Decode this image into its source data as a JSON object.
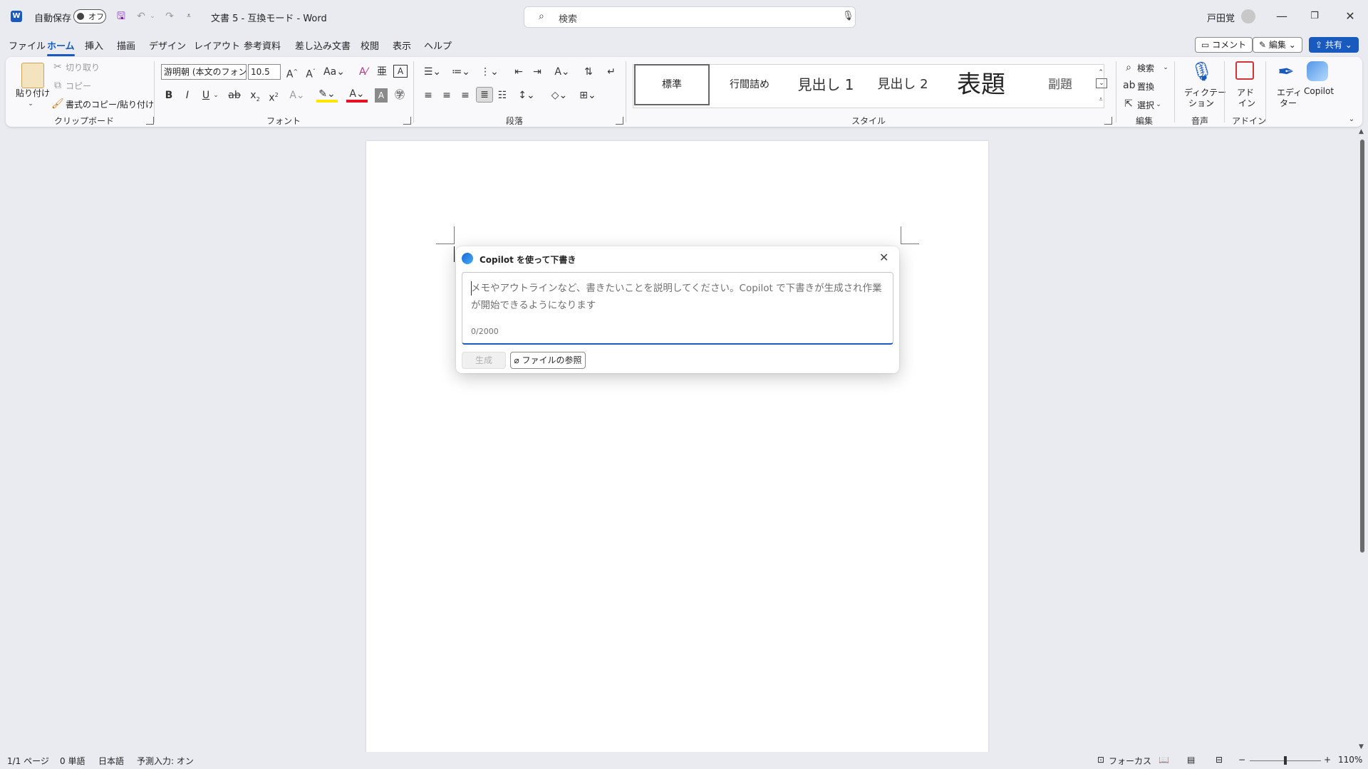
{
  "titlebar": {
    "autosave_label": "自動保存",
    "autosave_state": "オフ",
    "document_title": "文書 5 - 互換モード - Word",
    "search_placeholder": "検索",
    "user_name": "戸田覚"
  },
  "tabs": [
    "ファイル",
    "ホーム",
    "挿入",
    "描画",
    "デザイン",
    "レイアウト",
    "参考資料",
    "差し込み文書",
    "校閲",
    "表示",
    "ヘルプ"
  ],
  "top_buttons": {
    "comment": "コメント",
    "edit": "編集",
    "share": "共有"
  },
  "ribbon": {
    "clipboard": {
      "paste": "貼り付け",
      "cut": "切り取り",
      "copy": "コピー",
      "format_painter": "書式のコピー/貼り付け",
      "label": "クリップボード"
    },
    "font": {
      "font_name": "游明朝 (本文のフォン",
      "font_size": "10.5",
      "label": "フォント"
    },
    "paragraph": {
      "label": "段落"
    },
    "styles": {
      "items": [
        "標準",
        "行間詰め",
        "見出し 1",
        "見出し 2",
        "表題",
        "副題"
      ],
      "label": "スタイル"
    },
    "editing": {
      "find": "検索",
      "replace": "置換",
      "select": "選択",
      "label": "編集"
    },
    "voice": {
      "dictate": "ディクテー",
      "dictate2": "ション",
      "label": "音声"
    },
    "addins": {
      "addin": "アド",
      "addin2": "イン",
      "label": "アドイン"
    },
    "editor": {
      "label1": "エディ",
      "label2": "ター"
    },
    "copilot": {
      "label": "Copilot"
    }
  },
  "copilot_dialog": {
    "title": "Copilot を使って下書き",
    "placeholder": "メモやアウトラインなど、書きたいことを説明してください。Copilot で下書きが生成され作業が開始できるようになります",
    "counter": "0/2000",
    "generate": "生成",
    "reference_file": "ファイルの参照"
  },
  "statusbar": {
    "page": "1/1 ページ",
    "words": "0 単語",
    "language": "日本語",
    "predictive": "予測入力: オン",
    "focus": "フォーカス",
    "zoom": "110%"
  },
  "colors": {
    "accent": "#185abd",
    "word_blue": "#185abd",
    "share_bg": "#185abd"
  }
}
